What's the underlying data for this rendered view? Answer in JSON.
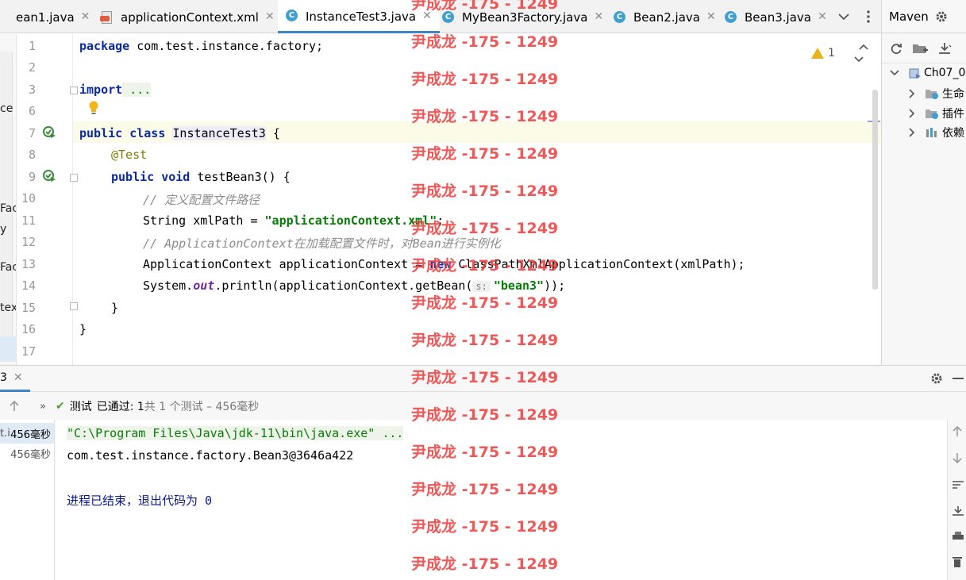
{
  "tabs": [
    {
      "label": "ean1.java",
      "icon": "none"
    },
    {
      "label": "applicationContext.xml",
      "icon": "xml-file-icon"
    },
    {
      "label": "InstanceTest3.java",
      "icon": "class-icon",
      "active": true
    },
    {
      "label": "MyBean3Factory.java",
      "icon": "class-icon"
    },
    {
      "label": "Bean2.java",
      "icon": "class-icon"
    },
    {
      "label": "Bean3.java",
      "icon": "class-icon"
    }
  ],
  "left_strip": {
    "fragments": [
      "ce",
      "Fac",
      "y",
      "Fac",
      "tex"
    ]
  },
  "editor": {
    "line_numbers": [
      "1",
      "2",
      "3",
      "6",
      "7",
      "8",
      "9",
      "10",
      "11",
      "12",
      "13",
      "14",
      "15",
      "16",
      "17"
    ],
    "inspection_count": "1",
    "code": {
      "l1_kw": "package",
      "l1_rest": " com.test.instance.factory;",
      "l3_kw": "import",
      "l3_rest": " ...",
      "l7_kw": "public class",
      "l7_cls": "InstanceTest3",
      "l7_rest": " {",
      "l8_ann": "@Test",
      "l9_kw": "public void",
      "l9_rest": " testBean3() {",
      "l10_cmt": "// 定义配置文件路径",
      "l11_a": "String xmlPath = ",
      "l11_str": "\"applicationContext.xml\"",
      "l11_b": ";",
      "l12_cmt": "// ApplicationContext在加载配置文件时，对Bean进行实例化",
      "l13_a": "ApplicationContext applicationContext = ",
      "l13_kw": "new",
      "l13_b": " ClassPathXmlApplicationContext(xmlPath);",
      "l14_a": "System.",
      "l14_fld": "out",
      "l14_b": ".println(applicationContext.getBean(",
      "l14_hint": "s:",
      "l14_str": "\"bean3\"",
      "l14_c": "));",
      "l15": "}",
      "l16": "}"
    }
  },
  "maven": {
    "title": "Maven",
    "project": "Ch07_0",
    "items": [
      "生命",
      "插件",
      "依赖"
    ]
  },
  "run_panel": {
    "tab_label": "3",
    "status_label": "测试",
    "status_passed": "已通过: 1",
    "status_detail": "共 1 个测试 – 456毫秒",
    "tree_rows": [
      {
        "name": "t.i",
        "time": "456毫秒"
      },
      {
        "name": "",
        "time": "456毫秒"
      }
    ],
    "console_lines": [
      "\"C:\\Program Files\\Java\\jdk-11\\bin\\java.exe\" ...",
      "com.test.instance.factory.Bean3@3646a422",
      "",
      "进程已结束，退出代码为 0"
    ]
  },
  "watermark": {
    "text": "尹成龙 -175 - 1249"
  },
  "colors": {
    "accent": "#4083c9",
    "keyword": "#0a2aa0",
    "string": "#077d07",
    "watermark": "#ee3a3a",
    "pass": "#4b9b3c"
  }
}
